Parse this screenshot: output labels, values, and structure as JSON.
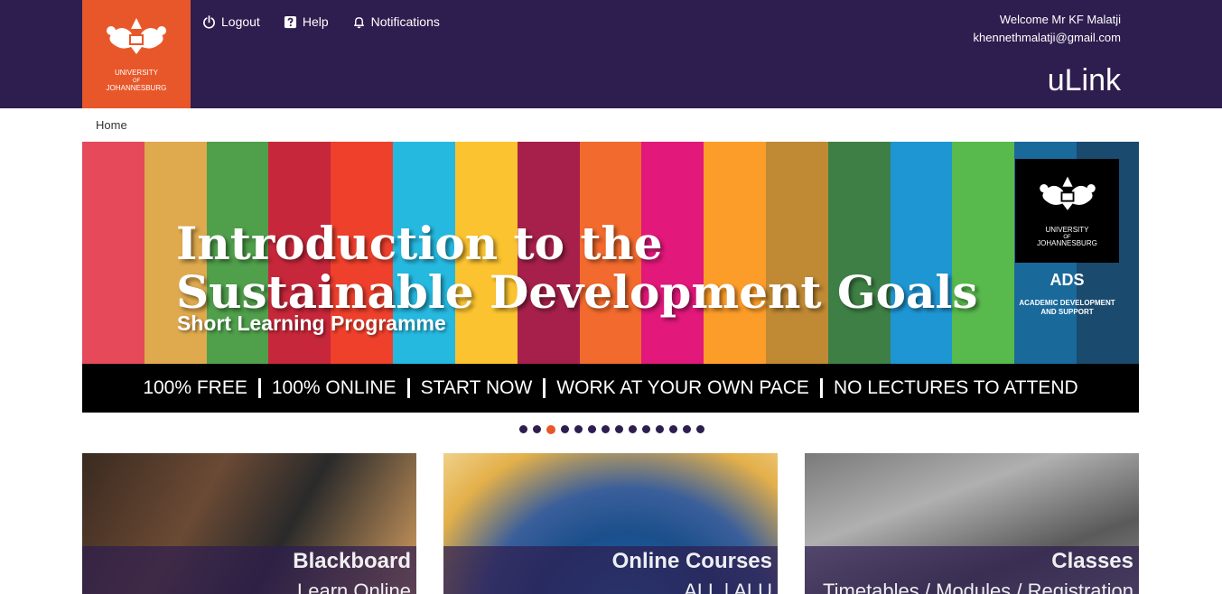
{
  "header": {
    "logo": {
      "line1": "UNIVERSITY",
      "line2": "OF",
      "line3": "JOHANNESBURG"
    },
    "nav": [
      {
        "label": "Logout",
        "icon": "power-icon"
      },
      {
        "label": "Help",
        "icon": "help-icon"
      },
      {
        "label": "Notifications",
        "icon": "bell-icon"
      }
    ],
    "welcome": "Welcome Mr KF Malatji",
    "email": "khennethmalatji@gmail.com",
    "brand": "uLink"
  },
  "breadcrumb": "Home",
  "banner": {
    "title_line1": "Introduction to the",
    "title_line2": "Sustainable Development Goals",
    "subtitle": "Short Learning Programme",
    "ads_logo": {
      "line1": "UNIVERSITY",
      "line2": "OF",
      "line3": "JOHANNESBURG"
    },
    "ads_name": "ADS",
    "ads_full_line1": "ACADEMIC DEVELOPMENT",
    "ads_full_line2": "AND SUPPORT",
    "bar_items": [
      "100% FREE",
      "100% ONLINE",
      "START NOW",
      "WORK AT YOUR OWN PACE",
      "NO LECTURES TO ATTEND"
    ],
    "stripe_colors": [
      "#e5495a",
      "#dfa94e",
      "#4f9f4b",
      "#c7273a",
      "#ef402c",
      "#26b9e0",
      "#fbc330",
      "#a6204b",
      "#f26a2d",
      "#e2187b",
      "#fd9d29",
      "#c08934",
      "#3e7f45",
      "#1f96d4",
      "#58b94c",
      "#19699b",
      "#1a4a6e"
    ]
  },
  "carousel": {
    "total": 14,
    "active": 3
  },
  "cards": [
    {
      "title": "Blackboard",
      "subtitle": "Learn Online"
    },
    {
      "title": "Online Courses",
      "subtitle": "ALL | ALU"
    },
    {
      "title": "Classes",
      "subtitle": "Timetables / Modules / Registration"
    }
  ],
  "colors": {
    "header_bg": "#2e1d4f",
    "logo_bg": "#e8572a",
    "accent": "#e8572a"
  }
}
